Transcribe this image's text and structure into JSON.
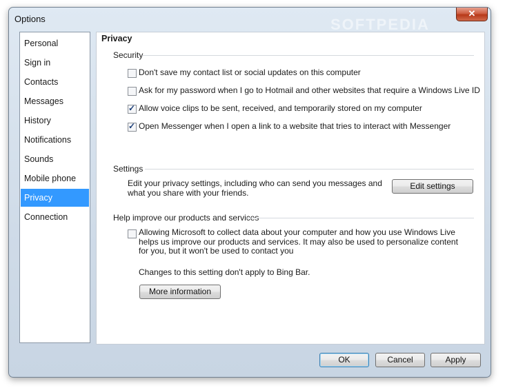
{
  "window": {
    "title": "Options",
    "close_label": "✕"
  },
  "sidebar": {
    "items": [
      {
        "label": "Personal"
      },
      {
        "label": "Sign in"
      },
      {
        "label": "Contacts"
      },
      {
        "label": "Messages"
      },
      {
        "label": "History"
      },
      {
        "label": "Notifications"
      },
      {
        "label": "Sounds"
      },
      {
        "label": "Mobile phone"
      },
      {
        "label": "Privacy",
        "selected": true
      },
      {
        "label": "Connection"
      }
    ]
  },
  "privacy": {
    "title": "Privacy",
    "security": {
      "heading": "Security",
      "options": [
        {
          "label": "Don't save my contact list or social updates on this computer",
          "checked": false
        },
        {
          "label": "Ask for my password when I go to Hotmail and other websites that require a Windows Live ID",
          "checked": false
        },
        {
          "label": "Allow voice clips to be sent, received, and temporarily stored on my computer",
          "checked": true
        },
        {
          "label": "Open Messenger when I open a link to a website that tries to interact with Messenger",
          "checked": true
        }
      ]
    },
    "settings": {
      "heading": "Settings",
      "description": "Edit your privacy settings, including who can send you messages and what you share with your friends.",
      "edit_button": "Edit settings"
    },
    "improve": {
      "heading": "Help improve our products and services",
      "checkbox_label": "Allowing Microsoft to collect data about your computer and how you use Windows Live helps us improve our products and services. It may also be used to personalize content for you, but it won't be used to contact you",
      "checked": false,
      "note": "Changes to this setting don't apply to Bing Bar.",
      "more_button": "More information"
    }
  },
  "footer": {
    "ok": "OK",
    "cancel": "Cancel",
    "apply": "Apply"
  },
  "watermark": "SOFTPEDIA"
}
